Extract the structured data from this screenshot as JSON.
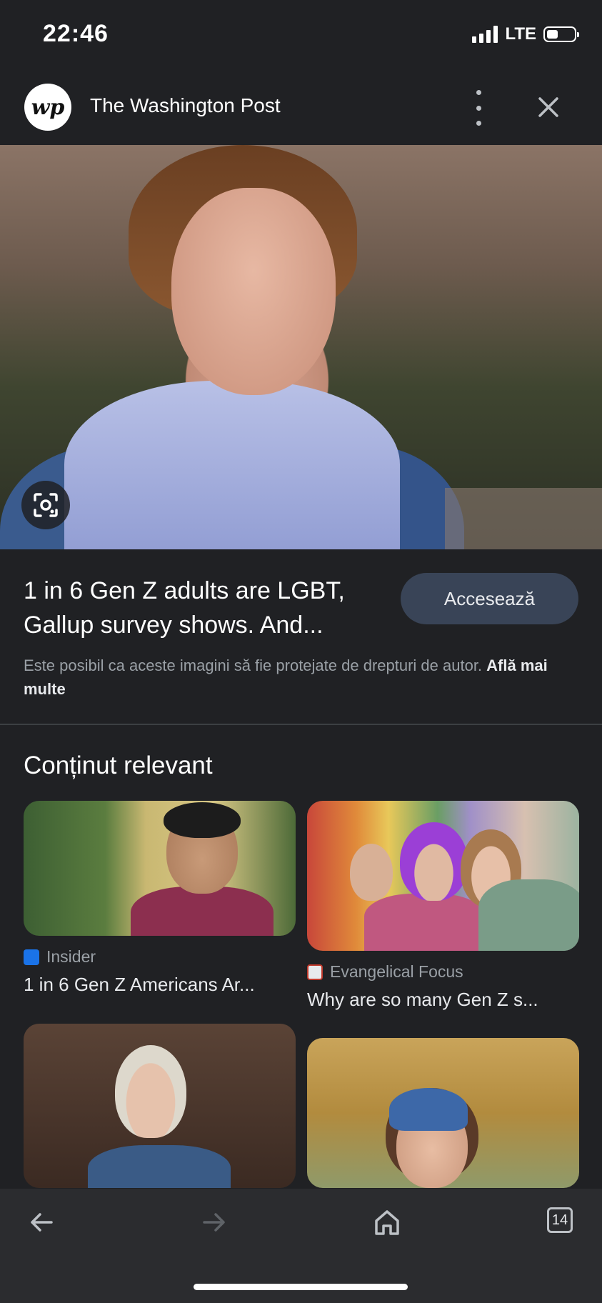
{
  "status_bar": {
    "time": "22:46",
    "network": "LTE",
    "battery_level": 0.35
  },
  "header": {
    "logo_text": "wp",
    "site_name": "The Washington Post",
    "more_icon": "more-vert-icon",
    "close_icon": "close-icon"
  },
  "hero": {
    "lens_icon": "google-lens-icon"
  },
  "result": {
    "headline": "1 in 6 Gen Z adults are LGBT, Gallup survey shows. And...",
    "visit_label": "Accesează",
    "notice_text": "Este posibil ca aceste imagini să fie protejate de drepturi de autor.",
    "learn_more": "Află mai multe"
  },
  "related": {
    "title": "Conținut relevant",
    "items": [
      {
        "source": "Insider",
        "title": "1 in 6 Gen Z Americans Ar...",
        "favicon_color": "#1a73e8"
      },
      {
        "source": "Evangelical Focus",
        "title": "Why are so many Gen Z s...",
        "favicon_color": "#e8eaed"
      },
      {
        "source": "",
        "title": ""
      },
      {
        "source": "",
        "title": ""
      }
    ]
  },
  "bottom_nav": {
    "back_icon": "arrow-left-icon",
    "forward_icon": "arrow-right-icon",
    "home_icon": "home-icon",
    "tab_count": "14"
  }
}
